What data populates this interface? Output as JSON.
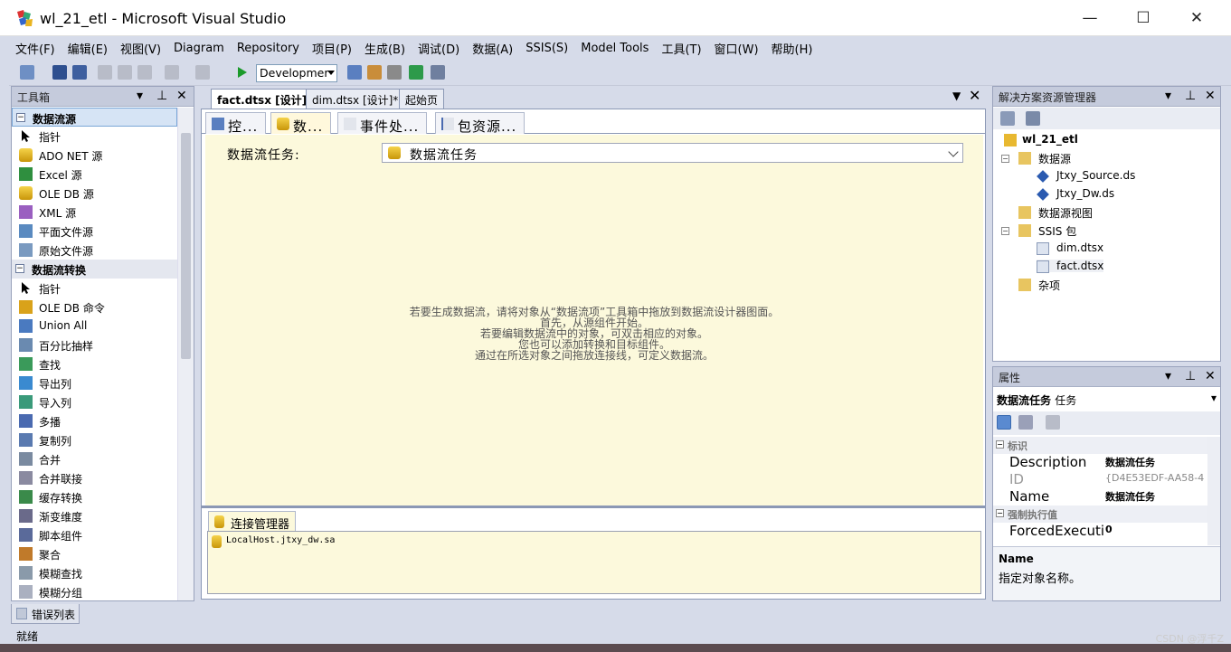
{
  "window": {
    "title": "wl_21_etl - Microsoft Visual Studio",
    "minimize": "—",
    "maximize": "☐",
    "close": "✕"
  },
  "menu": [
    "文件(F)",
    "编辑(E)",
    "视图(V)",
    "Diagram",
    "Repository",
    "项目(P)",
    "生成(B)",
    "调试(D)",
    "数据(A)",
    "SSIS(S)",
    "Model Tools",
    "工具(T)",
    "窗口(W)",
    "帮助(H)"
  ],
  "toolbar": {
    "config": "Developmer"
  },
  "toolbox": {
    "title": "工具箱",
    "categories": [
      {
        "name": "数据流源",
        "items": [
          "指针",
          "ADO NET 源",
          "Excel 源",
          "OLE DB 源",
          "XML 源",
          "平面文件源",
          "原始文件源"
        ]
      },
      {
        "name": "数据流转换",
        "items": [
          "指针",
          "OLE DB 命令",
          "Union All",
          "百分比抽样",
          "查找",
          "导出列",
          "导入列",
          "多播",
          "复制列",
          "合并",
          "合并联接",
          "缓存转换",
          "渐变维度",
          "脚本组件",
          "聚合",
          "模糊查找",
          "模糊分组"
        ]
      }
    ]
  },
  "doc_tabs": [
    "fact.dtsx [设计]*",
    "dim.dtsx [设计]*",
    "起始页"
  ],
  "designer_tabs": [
    "控...",
    "数...",
    "事件处...",
    "包资源..."
  ],
  "dataflow": {
    "label": "数据流任务:",
    "selected": "数据流任务",
    "hint_lines": [
      "若要生成数据流，请将对象从“数据流项”工具箱中拖放到数据流设计器图面。",
      "首先，从源组件开始。",
      "若要编辑数据流中的对象，可双击相应的对象。",
      "您也可以添加转换和目标组件。",
      "通过在所选对象之间拖放连接线，可定义数据流。"
    ]
  },
  "connection_manager": {
    "tab": "连接管理器",
    "items": [
      "LocalHost.jtxy_dw.sa"
    ]
  },
  "solution_explorer": {
    "title": "解决方案资源管理器",
    "project": "wl_21_etl",
    "data_sources": "数据源",
    "ds_items": [
      "Jtxy_Source.ds",
      "Jtxy_Dw.ds"
    ],
    "data_source_views": "数据源视图",
    "ssis_packages": "SSIS 包",
    "pkg_items": [
      "dim.dtsx",
      "fact.dtsx"
    ],
    "misc": "杂项"
  },
  "properties": {
    "title": "属性",
    "object": "数据流任务",
    "object_type": "任务",
    "categories": {
      "identity": "标识",
      "forced": "强制执行值"
    },
    "rows": [
      {
        "key": "Description",
        "value": "数据流任务"
      },
      {
        "key": "ID",
        "value": "{D4E53EDF-AA58-4"
      },
      {
        "key": "Name",
        "value": "数据流任务"
      },
      {
        "key": "ForcedExecuti",
        "value": "0"
      }
    ],
    "desc_title": "Name",
    "desc_text": "指定对象名称。"
  },
  "error_list": "错误列表",
  "status": "就绪",
  "watermark": "CSDN @浮千Z"
}
